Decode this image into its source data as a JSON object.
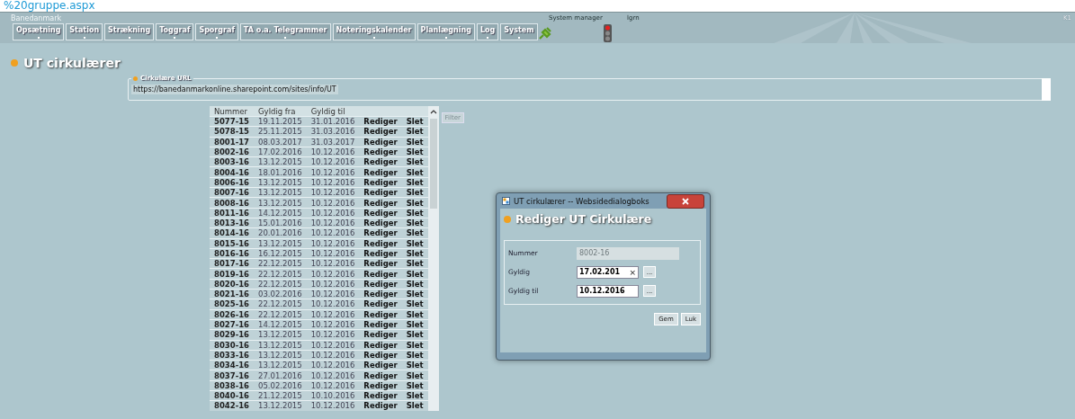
{
  "address_bar": {
    "text": "%20gruppe.aspx"
  },
  "header": {
    "brand": "Banedanmark",
    "user_role": "System manager",
    "user": "lgrn",
    "corner": "K1",
    "menu": [
      {
        "label": "Opsætning"
      },
      {
        "label": "Station"
      },
      {
        "label": "Strækning"
      },
      {
        "label": "Toggraf"
      },
      {
        "label": "Sporgraf"
      },
      {
        "label": "TA o.a. Telegrammer"
      },
      {
        "label": "Noteringskalender"
      },
      {
        "label": "Planlægning"
      },
      {
        "label": "Log"
      },
      {
        "label": "System"
      }
    ]
  },
  "page": {
    "title": "UT cirkulærer"
  },
  "url_field": {
    "legend": "Cirkulære URL",
    "value": "https://banedanmarkonline.sharepoint.com/sites/info/UT"
  },
  "table": {
    "columns": [
      "Nummer",
      "Gyldig fra",
      "Gyldig til"
    ],
    "rows": [
      {
        "nummer": "5077-15",
        "fra": "19.11.2015",
        "til": "31.01.2016",
        "edit": "Rediger",
        "delete": "Slet"
      },
      {
        "nummer": "5078-15",
        "fra": "25.11.2015",
        "til": "31.03.2016",
        "edit": "Rediger",
        "delete": "Slet"
      },
      {
        "nummer": "8001-17",
        "fra": "08.03.2017",
        "til": "31.03.2017",
        "edit": "Rediger",
        "delete": "Slet"
      },
      {
        "nummer": "8002-16",
        "fra": "17.02.2016",
        "til": "10.12.2016",
        "edit": "Rediger",
        "delete": "Slet"
      },
      {
        "nummer": "8003-16",
        "fra": "13.12.2015",
        "til": "10.12.2016",
        "edit": "Rediger",
        "delete": "Slet"
      },
      {
        "nummer": "8004-16",
        "fra": "18.01.2016",
        "til": "10.12.2016",
        "edit": "Rediger",
        "delete": "Slet"
      },
      {
        "nummer": "8006-16",
        "fra": "13.12.2015",
        "til": "10.12.2016",
        "edit": "Rediger",
        "delete": "Slet"
      },
      {
        "nummer": "8007-16",
        "fra": "13.12.2015",
        "til": "10.12.2016",
        "edit": "Rediger",
        "delete": "Slet"
      },
      {
        "nummer": "8008-16",
        "fra": "13.12.2015",
        "til": "10.12.2016",
        "edit": "Rediger",
        "delete": "Slet"
      },
      {
        "nummer": "8011-16",
        "fra": "14.12.2015",
        "til": "10.12.2016",
        "edit": "Rediger",
        "delete": "Slet"
      },
      {
        "nummer": "8013-16",
        "fra": "15.01.2016",
        "til": "10.12.2016",
        "edit": "Rediger",
        "delete": "Slet"
      },
      {
        "nummer": "8014-16",
        "fra": "20.01.2016",
        "til": "10.12.2016",
        "edit": "Rediger",
        "delete": "Slet"
      },
      {
        "nummer": "8015-16",
        "fra": "13.12.2015",
        "til": "10.12.2016",
        "edit": "Rediger",
        "delete": "Slet"
      },
      {
        "nummer": "8016-16",
        "fra": "16.12.2015",
        "til": "10.12.2016",
        "edit": "Rediger",
        "delete": "Slet"
      },
      {
        "nummer": "8017-16",
        "fra": "22.12.2015",
        "til": "10.12.2016",
        "edit": "Rediger",
        "delete": "Slet"
      },
      {
        "nummer": "8019-16",
        "fra": "22.12.2015",
        "til": "10.12.2016",
        "edit": "Rediger",
        "delete": "Slet"
      },
      {
        "nummer": "8020-16",
        "fra": "22.12.2015",
        "til": "10.12.2016",
        "edit": "Rediger",
        "delete": "Slet"
      },
      {
        "nummer": "8021-16",
        "fra": "03.02.2016",
        "til": "10.12.2016",
        "edit": "Rediger",
        "delete": "Slet"
      },
      {
        "nummer": "8025-16",
        "fra": "22.12.2015",
        "til": "10.12.2016",
        "edit": "Rediger",
        "delete": "Slet"
      },
      {
        "nummer": "8026-16",
        "fra": "22.12.2015",
        "til": "10.12.2016",
        "edit": "Rediger",
        "delete": "Slet"
      },
      {
        "nummer": "8027-16",
        "fra": "14.12.2015",
        "til": "10.12.2016",
        "edit": "Rediger",
        "delete": "Slet"
      },
      {
        "nummer": "8029-16",
        "fra": "13.12.2015",
        "til": "10.12.2016",
        "edit": "Rediger",
        "delete": "Slet"
      },
      {
        "nummer": "8030-16",
        "fra": "13.12.2015",
        "til": "10.12.2016",
        "edit": "Rediger",
        "delete": "Slet"
      },
      {
        "nummer": "8033-16",
        "fra": "13.12.2015",
        "til": "10.12.2016",
        "edit": "Rediger",
        "delete": "Slet"
      },
      {
        "nummer": "8034-16",
        "fra": "13.12.2015",
        "til": "10.12.2016",
        "edit": "Rediger",
        "delete": "Slet"
      },
      {
        "nummer": "8037-16",
        "fra": "27.01.2016",
        "til": "10.12.2016",
        "edit": "Rediger",
        "delete": "Slet"
      },
      {
        "nummer": "8038-16",
        "fra": "05.02.2016",
        "til": "10.12.2016",
        "edit": "Rediger",
        "delete": "Slet"
      },
      {
        "nummer": "8040-16",
        "fra": "21.12.2015",
        "til": "10.10.2016",
        "edit": "Rediger",
        "delete": "Slet"
      },
      {
        "nummer": "8042-16",
        "fra": "13.12.2015",
        "til": "10.12.2016",
        "edit": "Rediger",
        "delete": "Slet"
      }
    ]
  },
  "filter_button": {
    "label": "Filter",
    "disabled": true
  },
  "dialog": {
    "title": "UT cirkulærer -- Websidedialogboks",
    "heading": "Rediger UT Cirkulære",
    "fields": [
      {
        "label": "Nummer",
        "value": "8002-16",
        "disabled": true
      },
      {
        "label": "Gyldig",
        "value": "17.02.201",
        "clear": "×",
        "picker": "...",
        "disabled": false
      },
      {
        "label": "Gyldig til",
        "value": "10.12.2016",
        "picker": "...",
        "disabled": false
      }
    ],
    "buttons": [
      "Gem",
      "Luk"
    ]
  }
}
